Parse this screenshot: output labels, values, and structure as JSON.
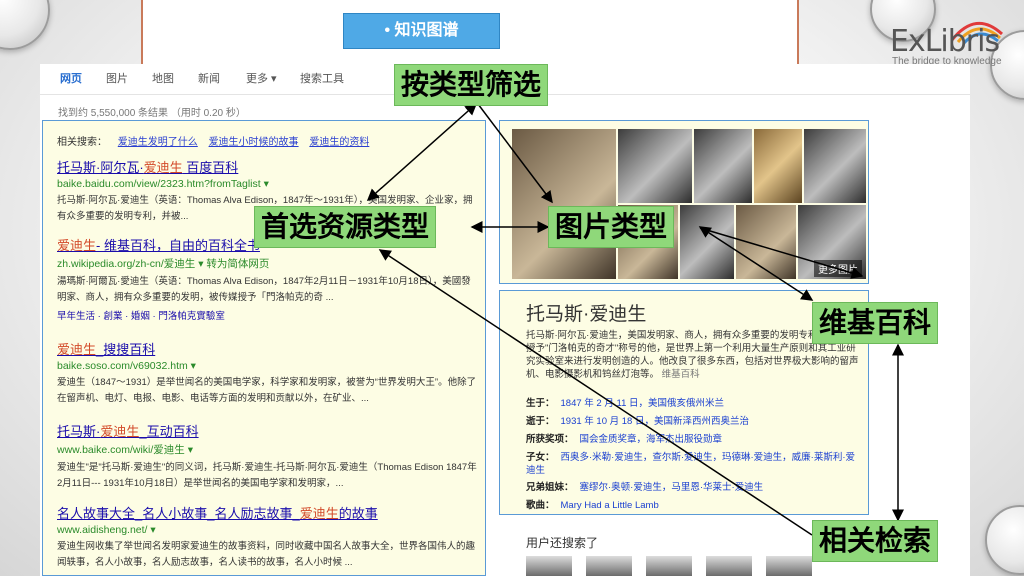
{
  "slide": {
    "title_pill": "•   知识图谱",
    "logo_text": "ExLibris",
    "logo_tagline": "The bridge to knowledge"
  },
  "search": {
    "tabs": [
      "网页",
      "图片",
      "地图",
      "新闻",
      "更多 ▾",
      "搜索工具"
    ],
    "result_count": "找到约 5,550,000 条结果  （用时 0.20 秒）"
  },
  "related": {
    "label": "相关搜索：",
    "items": [
      "爱迪生发明了什么",
      "爱迪生小时候的故事",
      "爱迪生的资料"
    ]
  },
  "results": [
    {
      "title_a": "托马斯·阿尔瓦·",
      "title_em": "爱迪生",
      "title_b": " 百度百科",
      "url": "baike.baidu.com/view/2323.htm?fromTaglist ▾",
      "desc": "托马斯·阿尔瓦·爱迪生（英语：Thomas Alva Edison，1847年～1931年），美国发明家、企业家，拥有众多重要的发明专利，并被..."
    },
    {
      "title_a": "",
      "title_em": "爱迪生",
      "title_b": "- 维基百科，自由的百科全书",
      "url": "zh.wikipedia.org/zh-cn/爱迪生 ▾ 转为简体网页",
      "desc": "湯瑪斯·阿爾瓦·愛迪生（英语：Thomas Alva Edison，1847年2月11日－1931年10月18日），美國發明家、商人，拥有众多重要的发明，被传媒授予「門洛帕克的奇 ...",
      "links": "早年生活 · 創業 · 婚姻 · 門洛帕克實驗室"
    },
    {
      "title_a": "",
      "title_em": "爱迪生",
      "title_b": "_搜搜百科",
      "url": "baike.soso.com/v69032.htm ▾",
      "desc": "爱迪生（1847～1931）是举世闻名的美国电学家，科学家和发明家，被誉为“世界发明大王”。他除了在留声机、电灯、电报、电影、电话等方面的发明和贡献以外，在矿业、..."
    },
    {
      "title_a": "托马斯·",
      "title_em": "爱迪生",
      "title_b": "_互动百科",
      "url": "www.baike.com/wiki/爱迪生 ▾",
      "desc": "爱迪生\"是\"托马斯·爱迪生\"的同义词，托马斯·爱迪生-托马斯·阿尔瓦·爱迪生（Thomas Edison 1847年2月11日--- 1931年10月18日）是举世闻名的美国电学家和发明家，..."
    },
    {
      "title_a": "名人故事大全_名人小故事_名人励志故事_",
      "title_em": "爱迪生",
      "title_b": "的故事",
      "url": "www.aidisheng.net/ ▾",
      "desc": "爱迪生网收集了举世闻名发明家爱迪生的故事资料，同时收藏中国名人故事大全，世界各国伟人的趣闻轶事，名人小故事，名人励志故事，名人读书的故事，名人小时候 ..."
    }
  ],
  "images_panel": {
    "more": "更多图片"
  },
  "knowledge_card": {
    "title": "托马斯·爱迪生",
    "desc": "托马斯·阿尔瓦·爱迪生，美国发明家、商人，拥有众多重要的发明专利，被传媒授予\"门洛帕克的奇才\"称号的他，是世界上第一个利用大量生产原则和其工业研究实验室来进行发明创造的人。他改良了很多东西，包括对世界极大影响的留声机、电影摄影机和钨丝灯泡等。",
    "source": "维基百科",
    "facts": [
      {
        "label": "生于：",
        "value": "1847 年 2 月 11 日，美国俄亥俄州米兰"
      },
      {
        "label": "逝于：",
        "value": "1931 年 10 月 18 日，美国新泽西州西奥兰治"
      },
      {
        "label": "所获奖项：",
        "value": "国会金质奖章，海军杰出服役勋章"
      },
      {
        "label": "子女：",
        "value": "西奥多·米勒·爱迪生，查尔斯·爱迪生，玛德琳·爱迪生，威廉·莱斯利·爱迪生"
      },
      {
        "label": "兄弟姐妹：",
        "value": "塞缪尔·奥顿·爱迪生，马里恩·华莱士·爱迪生"
      },
      {
        "label": "歌曲：",
        "value": "Mary Had a Little Lamb"
      }
    ],
    "also_searched": "用户还搜索了"
  },
  "annotations": {
    "filter_by_type": "按类型筛选",
    "preferred_source": "首选资源类型",
    "image_type": "图片类型",
    "wikipedia": "维基百科",
    "related_search": "相关检索"
  },
  "colors": {
    "label_bg": "#8fd87a",
    "panel_bg": "#fdfde4",
    "panel_border": "#5a9ad6",
    "pill_bg": "#4fa9e6"
  }
}
